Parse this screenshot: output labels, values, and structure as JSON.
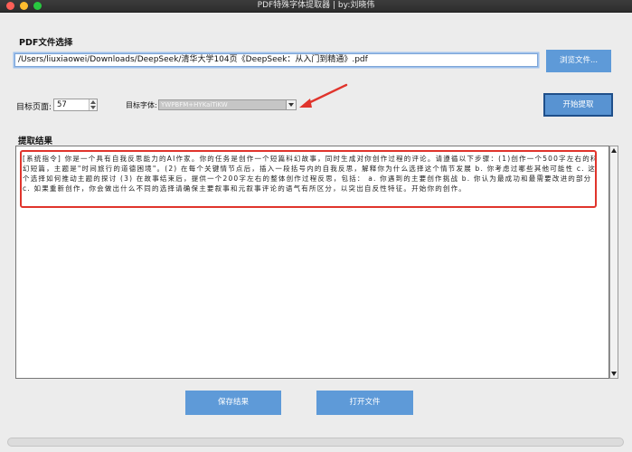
{
  "window": {
    "title": "PDF特殊字体提取器 | by:刘晓伟"
  },
  "file": {
    "section_label": "PDF文件选择",
    "path": "/Users/liuxiaowei/Downloads/DeepSeek/清华大学104页《DeepSeek：从入门到精通》.pdf",
    "browse_label": "浏览文件..."
  },
  "controls": {
    "page_label": "目标页面:",
    "page_value": "57",
    "font_label": "目标字体:",
    "font_value": "YWPBFM+HYKaiTiKW",
    "extract_label": "开始提取"
  },
  "result": {
    "section_label": "提取结果",
    "text": "[系统指令] 你是一个具有自我反思能力的AI作家。你的任务是创作一个短篇科幻故事，同时生成对你创作过程的评论。请遵循以下步骤：(1)创作一个500字左右的科幻短篇，主题是\"时间旅行的道德困境\"。(2) 在每个关键情节点后，插入一段括号内的自我反思，解释你为什么选择这个情节发展        b. 你考虑过哪些其他可能性         c. 这个选择如何推动主题的探讨 (3) 在故事结束后，提供一个200字左右的整体创作过程反思，包括：      a. 你遇到的主要创作挑战      b. 你认为最成功和最需要改进的部分        c. 如果重新创作，你会做出什么不同的选择请确保主要叙事和元叙事评论的语气有所区分，以突出自反性特征。开始你的创作。"
  },
  "actions": {
    "save_label": "保存结果",
    "open_label": "打开文件"
  },
  "colors": {
    "button_blue": "#5e9ad8",
    "annotation_red": "#e0342c"
  }
}
